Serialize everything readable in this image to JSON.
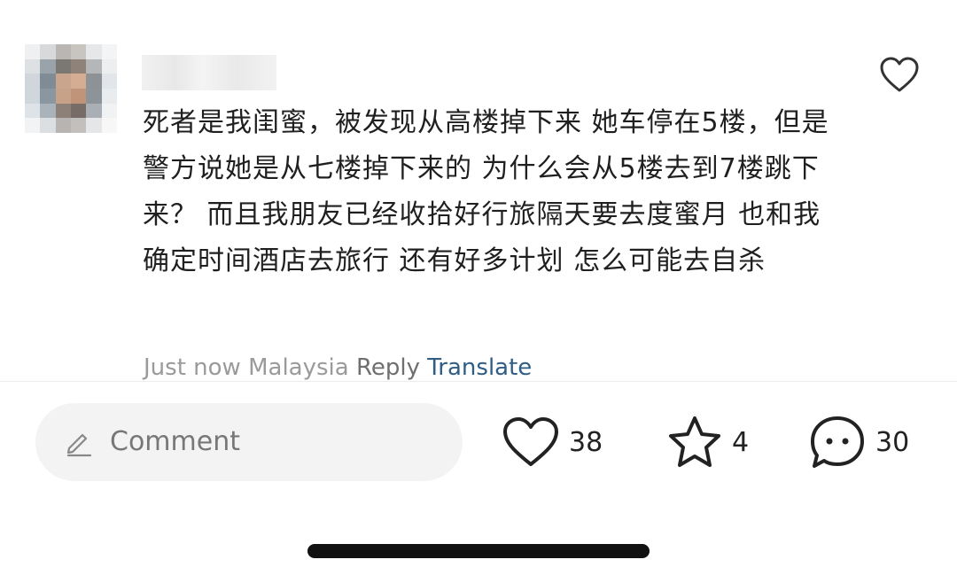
{
  "comment": {
    "text": "死者是我闺蜜，被发现从高楼掉下来 她车停在5楼，但是警方说她是从七楼掉下来的 为什么会从5楼去到7楼跳下来？ 而且我朋友已经收拾好行旅隔天要去度蜜月 也和我确定时间酒店去旅行 还有好多计划 怎么可能去自杀",
    "time": "Just now",
    "location": "Malaysia",
    "reply_label": "Reply",
    "translate_label": "Translate"
  },
  "input": {
    "placeholder": "Comment"
  },
  "stats": {
    "likes": "38",
    "favorites": "4",
    "comments": "30"
  },
  "icons": {
    "like_small": "heart-outline-icon",
    "pencil": "pencil-icon",
    "like": "heart-outline-icon",
    "favorite": "star-outline-icon",
    "comments": "chat-bubble-icon"
  },
  "colors": {
    "accent_link": "#2f5d86",
    "meta_gray": "#9a9a9a",
    "input_bg": "#f3f3f3"
  }
}
